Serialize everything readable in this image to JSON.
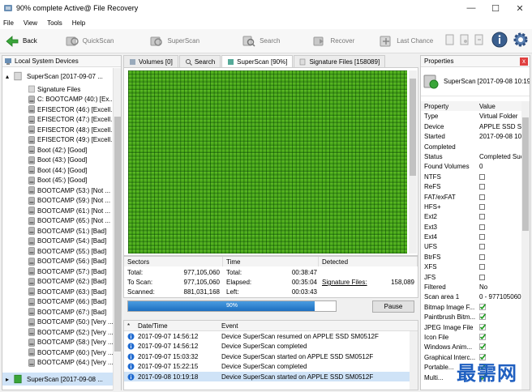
{
  "window": {
    "title": "90% complete Active@ File Recovery",
    "controls": {
      "minimize": "—",
      "maximize": "☐",
      "close": "✕"
    }
  },
  "menu": [
    "File",
    "View",
    "Tools",
    "Help"
  ],
  "toolbar": {
    "back": "Back",
    "quickscan": "QuickScan",
    "superscan": "SuperScan",
    "search": "Search",
    "recover": "Recover",
    "lastchance": "Last Chance"
  },
  "left_panel": {
    "header": "Local System Devices",
    "items": [
      "SuperScan [2017-09-07 ...",
      "Signature Files",
      "C: BOOTCAMP (40:) [Ex...",
      "EFISECTOR (46:) [Excell...",
      "EFISECTOR (47:) [Excell...",
      "EFISECTOR (48:) [Excell...",
      "EFISECTOR (49:) [Excell...",
      "Boot (42:) [Good]",
      "Boot (43:) [Good]",
      "Boot (44:) [Good]",
      "Boot (45:) [Good]",
      "BOOTCAMP (53:) [Not ...",
      "BOOTCAMP (59:) [Not ...",
      "BOOTCAMP (61:) [Not ...",
      "BOOTCAMP (65:) [Not ...",
      "BOOTCAMP (51:) [Bad]",
      "BOOTCAMP (54:) [Bad]",
      "BOOTCAMP (55:) [Bad]",
      "BOOTCAMP (56:) [Bad]",
      "BOOTCAMP (57:) [Bad]",
      "BOOTCAMP (62:) [Bad]",
      "BOOTCAMP (63:) [Bad]",
      "BOOTCAMP (66:) [Bad]",
      "BOOTCAMP (67:) [Bad]",
      "BOOTCAMP (50:) [Very ...",
      "BOOTCAMP (52:) [Very ...",
      "BOOTCAMP (58:) [Very ...",
      "BOOTCAMP (60:) [Very ...",
      "BOOTCAMP (64:) [Very ..."
    ],
    "bottom_item": "SuperScan [2017-09-08 ..."
  },
  "tabs": [
    "Volumes [0]",
    "Search",
    "SuperScan [90%]",
    "Signature Files [158089]"
  ],
  "stats": {
    "headers": {
      "sectors": "Sectors",
      "time": "Time",
      "detected": "Detected"
    },
    "total_label": "Total:",
    "total_value": "977,105,060",
    "toscan_label": "To Scan:",
    "toscan_value": "977,105,060",
    "scanned_label": "Scanned:",
    "scanned_value": "881,031,168",
    "time_total_label": "Total:",
    "time_total_value": "00:38:47",
    "elapsed_label": "Elapsed:",
    "elapsed_value": "00:35:04",
    "left_label": "Left:",
    "left_value": "00:03:43",
    "sigfiles_label": "Signature Files:",
    "sigfiles_value": "158,089"
  },
  "progress": {
    "percent": 90,
    "label": "90%",
    "pause": "Pause"
  },
  "log": {
    "headers": {
      "num": "*",
      "date": "Date/Time",
      "event": "Event"
    },
    "rows": [
      {
        "date": "2017-09-07 14:56:12",
        "event": "Device SuperScan resumed on APPLE SSD SM0512F"
      },
      {
        "date": "2017-09-07 14:56:12",
        "event": "Device SuperScan completed"
      },
      {
        "date": "2017-09-07 15:03:32",
        "event": "Device SuperScan started on APPLE SSD SM0512F"
      },
      {
        "date": "2017-09-07 15:22:15",
        "event": "Device SuperScan completed"
      },
      {
        "date": "2017-09-08 10:19:18",
        "event": "Device SuperScan started on APPLE SSD SM0512F"
      }
    ]
  },
  "properties": {
    "header": "Properties",
    "close": "x",
    "object": "SuperScan [2017-09-08 10:19:18]",
    "col_property": "Property",
    "col_value": "Value",
    "rows": [
      {
        "name": "Type",
        "value": "Virtual Folder",
        "kind": "text"
      },
      {
        "name": "Device",
        "value": "APPLE SSD SM0",
        "kind": "text"
      },
      {
        "name": "Started",
        "value": "2017-09-08 10",
        "kind": "text"
      },
      {
        "name": "Completed",
        "value": "",
        "kind": "text"
      },
      {
        "name": "Status",
        "value": "Completed Suc",
        "kind": "text"
      },
      {
        "name": "Found Volumes",
        "value": "0",
        "kind": "text"
      },
      {
        "name": "NTFS",
        "value": "",
        "kind": "unchecked"
      },
      {
        "name": "ReFS",
        "value": "",
        "kind": "unchecked"
      },
      {
        "name": "FAT/exFAT",
        "value": "",
        "kind": "unchecked"
      },
      {
        "name": "HFS+",
        "value": "",
        "kind": "unchecked"
      },
      {
        "name": "Ext2",
        "value": "",
        "kind": "unchecked"
      },
      {
        "name": "Ext3",
        "value": "",
        "kind": "unchecked"
      },
      {
        "name": "Ext4",
        "value": "",
        "kind": "unchecked"
      },
      {
        "name": "UFS",
        "value": "",
        "kind": "unchecked"
      },
      {
        "name": "BtrFS",
        "value": "",
        "kind": "unchecked"
      },
      {
        "name": "XFS",
        "value": "",
        "kind": "unchecked"
      },
      {
        "name": "JFS",
        "value": "",
        "kind": "unchecked"
      },
      {
        "name": "Filtered",
        "value": "No",
        "kind": "text"
      },
      {
        "name": "Scan area 1",
        "value": "0 - 977105060",
        "kind": "text"
      },
      {
        "name": "Bitmap Image F...",
        "value": "",
        "kind": "checked"
      },
      {
        "name": "Paintbrush Bitm...",
        "value": "",
        "kind": "checked"
      },
      {
        "name": "JPEG Image File",
        "value": "",
        "kind": "checked"
      },
      {
        "name": "Icon File",
        "value": "",
        "kind": "checked"
      },
      {
        "name": "Windows Anim...",
        "value": "",
        "kind": "checked"
      },
      {
        "name": "Graphical Interc...",
        "value": "",
        "kind": "checked"
      },
      {
        "name": "Portable...",
        "value": "",
        "kind": "checked"
      },
      {
        "name": "Multi...",
        "value": "",
        "kind": "checked"
      }
    ]
  },
  "watermark": "最需网",
  "colors": {
    "grid": "#3b9c0f",
    "progress": "#1d6fc0",
    "selection": "#cfe3f7"
  }
}
